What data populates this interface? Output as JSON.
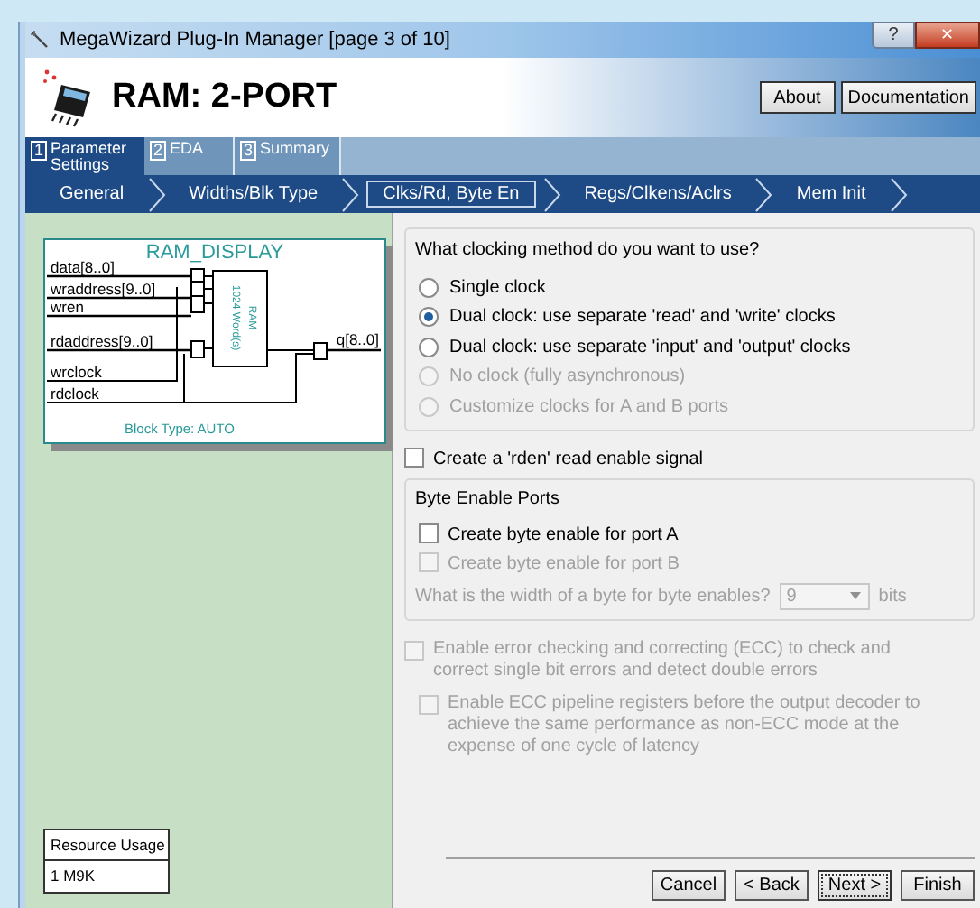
{
  "window": {
    "title": "MegaWizard Plug-In Manager [page 3 of 10]",
    "help": "?",
    "close": "✕"
  },
  "header": {
    "title": "RAM: 2-PORT",
    "buttons": [
      {
        "label": "About"
      },
      {
        "label": "Documentation"
      }
    ]
  },
  "tabs": [
    {
      "number": "1",
      "label": "Parameter Settings",
      "selected": true
    },
    {
      "number": "2",
      "label": "EDA",
      "selected": false
    },
    {
      "number": "3",
      "label": "Summary",
      "selected": false
    }
  ],
  "steps": [
    {
      "label": "General",
      "selected": false
    },
    {
      "label": "Widths/Blk Type",
      "selected": false
    },
    {
      "label": "Clks/Rd, Byte En",
      "selected": true
    },
    {
      "label": "Regs/Clkens/Aclrs",
      "selected": false
    },
    {
      "label": "Mem Init",
      "selected": false
    }
  ],
  "diagram": {
    "title": "RAM_DISPLAY",
    "inputs": [
      "data[8..0]",
      "wraddress[9..0]",
      "wren",
      "rdaddress[9..0]",
      "wrclock",
      "rdclock"
    ],
    "output": "q[8..0]",
    "block_lines": [
      "1024 Word(s)",
      "RAM"
    ],
    "footer": "Block Type: AUTO"
  },
  "clocking": {
    "question": "What clocking method do you want to use?",
    "options": [
      {
        "label": "Single clock",
        "selected": false,
        "disabled": false
      },
      {
        "label": "Dual clock: use separate 'read' and 'write' clocks",
        "selected": true,
        "disabled": false
      },
      {
        "label": "Dual clock: use separate 'input' and 'output' clocks",
        "selected": false,
        "disabled": false
      },
      {
        "label": "No clock (fully asynchronous)",
        "selected": false,
        "disabled": true
      },
      {
        "label": "Customize clocks for A and B ports",
        "selected": false,
        "disabled": true
      }
    ]
  },
  "rden": {
    "label": "Create a 'rden' read enable signal",
    "checked": false,
    "disabled": false
  },
  "byte_enable": {
    "title": "Byte Enable Ports",
    "options": [
      {
        "label": "Create byte enable for port A",
        "checked": false,
        "disabled": false
      },
      {
        "label": "Create byte enable for port B",
        "checked": false,
        "disabled": true
      }
    ],
    "width_question": "What is the width of a byte for byte enables?",
    "width_value": "9",
    "width_unit": "bits",
    "width_disabled": true
  },
  "ecc": {
    "label": "Enable error checking and correcting (ECC) to check and correct single bit errors and detect double errors",
    "checked": false,
    "disabled": true,
    "children": [
      {
        "label": "Enable ECC pipeline registers before the output decoder to achieve the same performance as non-ECC mode at the expense of one cycle of latency",
        "checked": false,
        "disabled": true
      }
    ]
  },
  "resource_usage": {
    "title": "Resource Usage",
    "value": "1 M9K"
  },
  "footer_buttons": [
    {
      "label": "Cancel",
      "focused": false
    },
    {
      "label": "< Back",
      "focused": false
    },
    {
      "label": "Next >",
      "focused": true
    },
    {
      "label": "Finish",
      "focused": false
    }
  ]
}
